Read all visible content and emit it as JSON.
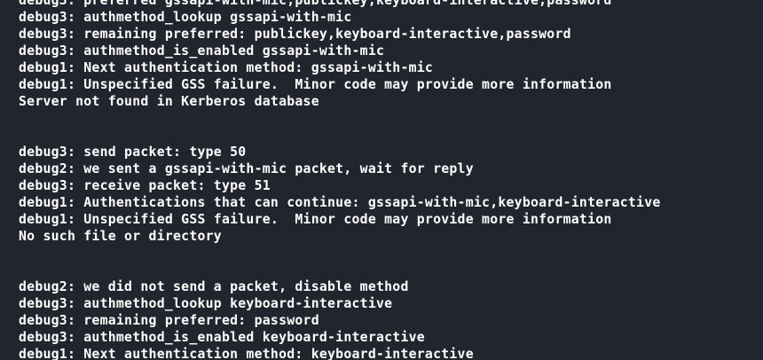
{
  "terminal": {
    "lines": [
      "debug3: preferred gssapi-with-mic,publickey,keyboard-interactive,password",
      "debug3: authmethod_lookup gssapi-with-mic",
      "debug3: remaining preferred: publickey,keyboard-interactive,password",
      "debug3: authmethod_is_enabled gssapi-with-mic",
      "debug1: Next authentication method: gssapi-with-mic",
      "debug1: Unspecified GSS failure.  Minor code may provide more information",
      "Server not found in Kerberos database",
      "",
      "",
      "debug3: send packet: type 50",
      "debug2: we sent a gssapi-with-mic packet, wait for reply",
      "debug3: receive packet: type 51",
      "debug1: Authentications that can continue: gssapi-with-mic,keyboard-interactive",
      "debug1: Unspecified GSS failure.  Minor code may provide more information",
      "No such file or directory",
      "",
      "",
      "debug2: we did not send a packet, disable method",
      "debug3: authmethod_lookup keyboard-interactive",
      "debug3: remaining preferred: password",
      "debug3: authmethod_is_enabled keyboard-interactive",
      "debug1: Next authentication method: keyboard-interactive"
    ]
  }
}
